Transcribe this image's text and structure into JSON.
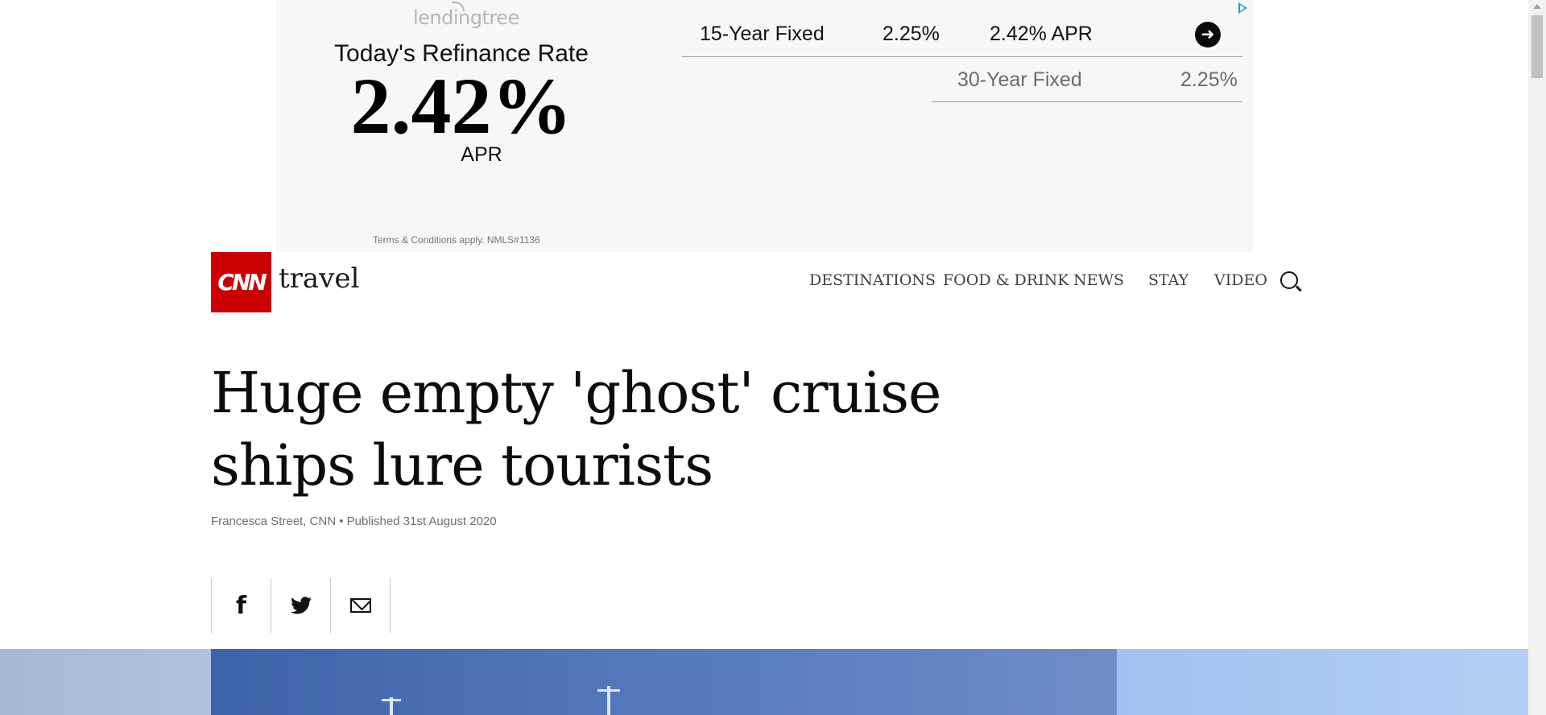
{
  "ad": {
    "brand": "lendingtree",
    "heading": "Today's Refinance Rate",
    "big_rate": "2.42%",
    "apr_label": "APR",
    "terms": "Terms & Conditions apply. NMLS#1136",
    "rows": [
      {
        "term": "15-Year Fixed",
        "rate": "2.25%",
        "apr": "2.42% APR"
      },
      {
        "term": "30-Year Fixed",
        "rate": "2.25%"
      }
    ],
    "go_icon": "arrow-right-icon",
    "adchoices_icon": "adchoices-icon",
    "colors": {
      "background": "#f7f7f7",
      "adchoices": "#1a9ee5"
    }
  },
  "header": {
    "logo_text": "CNN",
    "section": "travel",
    "nav": [
      "DESTINATIONS",
      "FOOD & DRINK",
      "NEWS",
      "STAY",
      "VIDEO"
    ],
    "search_icon": "search-icon",
    "colors": {
      "brand": "#cc0000"
    }
  },
  "article": {
    "headline": "Huge empty 'ghost' cruise ships lure tourists",
    "byline": "Francesca Street, CNN • Published 31st August 2020",
    "share": [
      {
        "icon": "facebook-icon"
      },
      {
        "icon": "twitter-icon"
      },
      {
        "icon": "email-icon"
      }
    ]
  }
}
